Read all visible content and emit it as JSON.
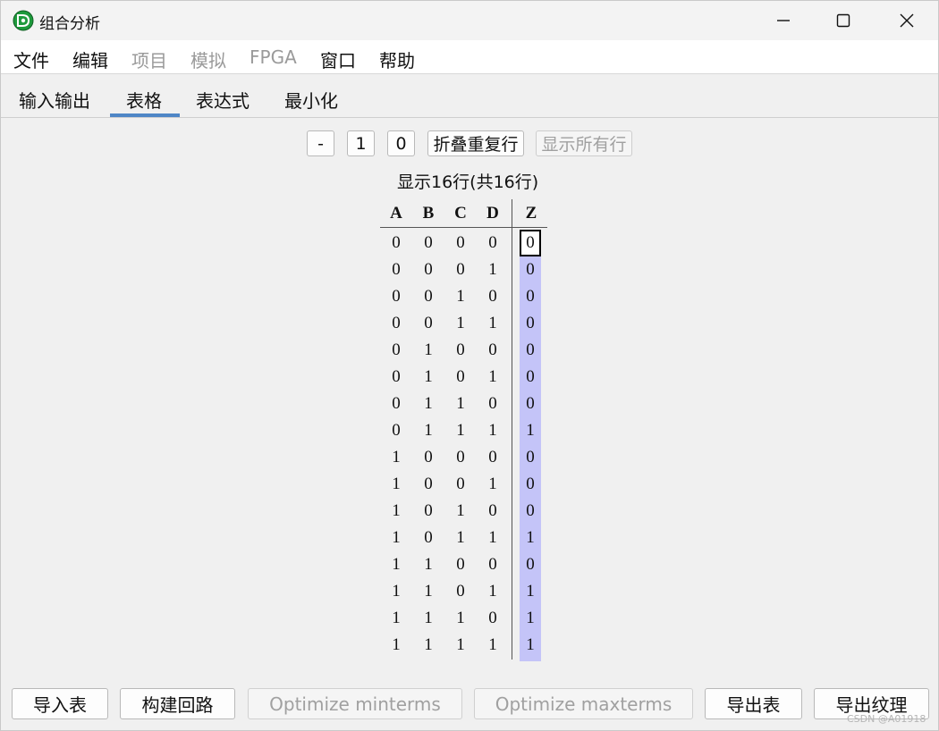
{
  "window": {
    "title": "组合分析"
  },
  "menu": [
    {
      "label": "文件",
      "enabled": true
    },
    {
      "label": "编辑",
      "enabled": true
    },
    {
      "label": "项目",
      "enabled": false
    },
    {
      "label": "模拟",
      "enabled": false
    },
    {
      "label": "FPGA",
      "enabled": false
    },
    {
      "label": "窗口",
      "enabled": true
    },
    {
      "label": "帮助",
      "enabled": true
    }
  ],
  "tabs": [
    {
      "label": "输入输出",
      "active": false
    },
    {
      "label": "表格",
      "active": true
    },
    {
      "label": "表达式",
      "active": false
    },
    {
      "label": "最小化",
      "active": false
    }
  ],
  "controls": {
    "dash": "-",
    "one": "1",
    "zero": "0",
    "collapse": "折叠重复行",
    "show_all": "显示所有行"
  },
  "row_count_label": "显示16行(共16行)",
  "truth_table": {
    "inputs": [
      "A",
      "B",
      "C",
      "D"
    ],
    "outputs": [
      "Z"
    ],
    "rows": [
      [
        "0",
        "0",
        "0",
        "0",
        "0"
      ],
      [
        "0",
        "0",
        "0",
        "1",
        "0"
      ],
      [
        "0",
        "0",
        "1",
        "0",
        "0"
      ],
      [
        "0",
        "0",
        "1",
        "1",
        "0"
      ],
      [
        "0",
        "1",
        "0",
        "0",
        "0"
      ],
      [
        "0",
        "1",
        "0",
        "1",
        "0"
      ],
      [
        "0",
        "1",
        "1",
        "0",
        "0"
      ],
      [
        "0",
        "1",
        "1",
        "1",
        "1"
      ],
      [
        "1",
        "0",
        "0",
        "0",
        "0"
      ],
      [
        "1",
        "0",
        "0",
        "1",
        "0"
      ],
      [
        "1",
        "0",
        "1",
        "0",
        "0"
      ],
      [
        "1",
        "0",
        "1",
        "1",
        "1"
      ],
      [
        "1",
        "1",
        "0",
        "0",
        "0"
      ],
      [
        "1",
        "1",
        "0",
        "1",
        "1"
      ],
      [
        "1",
        "1",
        "1",
        "0",
        "1"
      ],
      [
        "1",
        "1",
        "1",
        "1",
        "1"
      ]
    ],
    "selected_row": 0
  },
  "bottom_buttons": [
    {
      "label": "导入表",
      "enabled": true
    },
    {
      "label": "构建回路",
      "enabled": true
    },
    {
      "label": "Optimize minterms",
      "enabled": false
    },
    {
      "label": "Optimize maxterms",
      "enabled": false
    },
    {
      "label": "导出表",
      "enabled": true
    },
    {
      "label": "导出纹理",
      "enabled": true
    }
  ],
  "watermark": "CSDN @A01918",
  "colors": {
    "output_column": "#c4c4f8",
    "tab_underline": "#4f86c6",
    "app_icon": "#1e9a3c"
  },
  "icons": {
    "app": "logisim-app-icon",
    "minimize": "minimize-icon",
    "maximize": "maximize-icon",
    "close": "close-icon"
  }
}
